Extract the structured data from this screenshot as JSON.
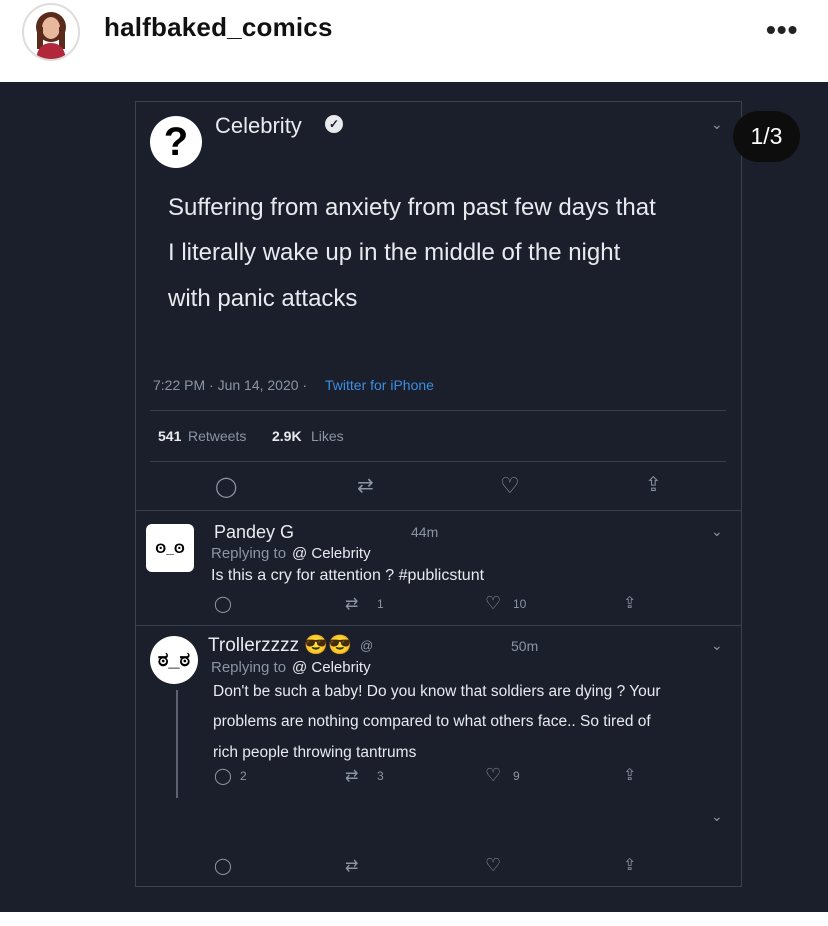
{
  "header": {
    "username": "halfbaked_comics",
    "more": "•••"
  },
  "carousel": {
    "counter": "1/3"
  },
  "tweet": {
    "author": "Celebrity",
    "text_line1": "Suffering from anxiety from past few days that",
    "text_line2": "I literally wake up in the middle of the night",
    "text_line3": "with panic attacks",
    "time": "7:22 PM · Jun 14, 2020 ·",
    "source": "Twitter for iPhone",
    "retweets_count": "541",
    "retweets_label": "Retweets",
    "likes_count": "2.9K",
    "likes_label": "Likes"
  },
  "replies": [
    {
      "name": "Pandey G",
      "time": "44m",
      "replying_prefix": "Replying to",
      "replying_handle": "@ Celebrity",
      "text": "Is this a cry for attention ? #publicstunt",
      "retweets": "1",
      "likes": "10"
    },
    {
      "name": "Trollerzzzz 😎😎",
      "handle": "@",
      "time": "50m",
      "replying_prefix": "Replying to",
      "replying_handle": "@ Celebrity",
      "text_line1": "Don't be such a baby! Do you know that soldiers are dying ? Your",
      "text_line2": "problems are nothing compared to what others face.. So tired of",
      "text_line3": "rich people throwing tantrums",
      "replies": "2",
      "retweets": "3",
      "likes": "9"
    }
  ],
  "icons": {
    "reply": "reply-icon",
    "retweet": "retweet-icon",
    "like": "heart-icon",
    "share": "share-icon",
    "chevron": "chevron-down-icon",
    "verified": "verified-icon"
  }
}
